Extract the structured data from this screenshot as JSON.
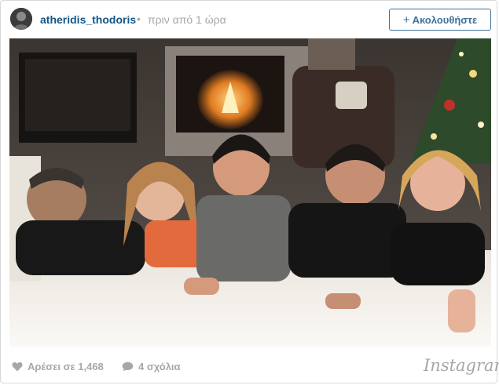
{
  "header": {
    "username": "atheridis_thodoris",
    "separator": "•",
    "time": "πριν από 1 ώρα",
    "follow_label": "Ακολουθήστε"
  },
  "photo": {
    "alt": "Group photo of five friends lying on a white sofa in a living room with a fireplace and a Christmas tree"
  },
  "footer": {
    "likes": "Αρέσει σε 1,468",
    "comments": "4 σχόλια",
    "logo": "Instagram"
  },
  "colors": {
    "username": "#125688",
    "follow": "#3f729b",
    "meta": "#a5a7aa"
  }
}
